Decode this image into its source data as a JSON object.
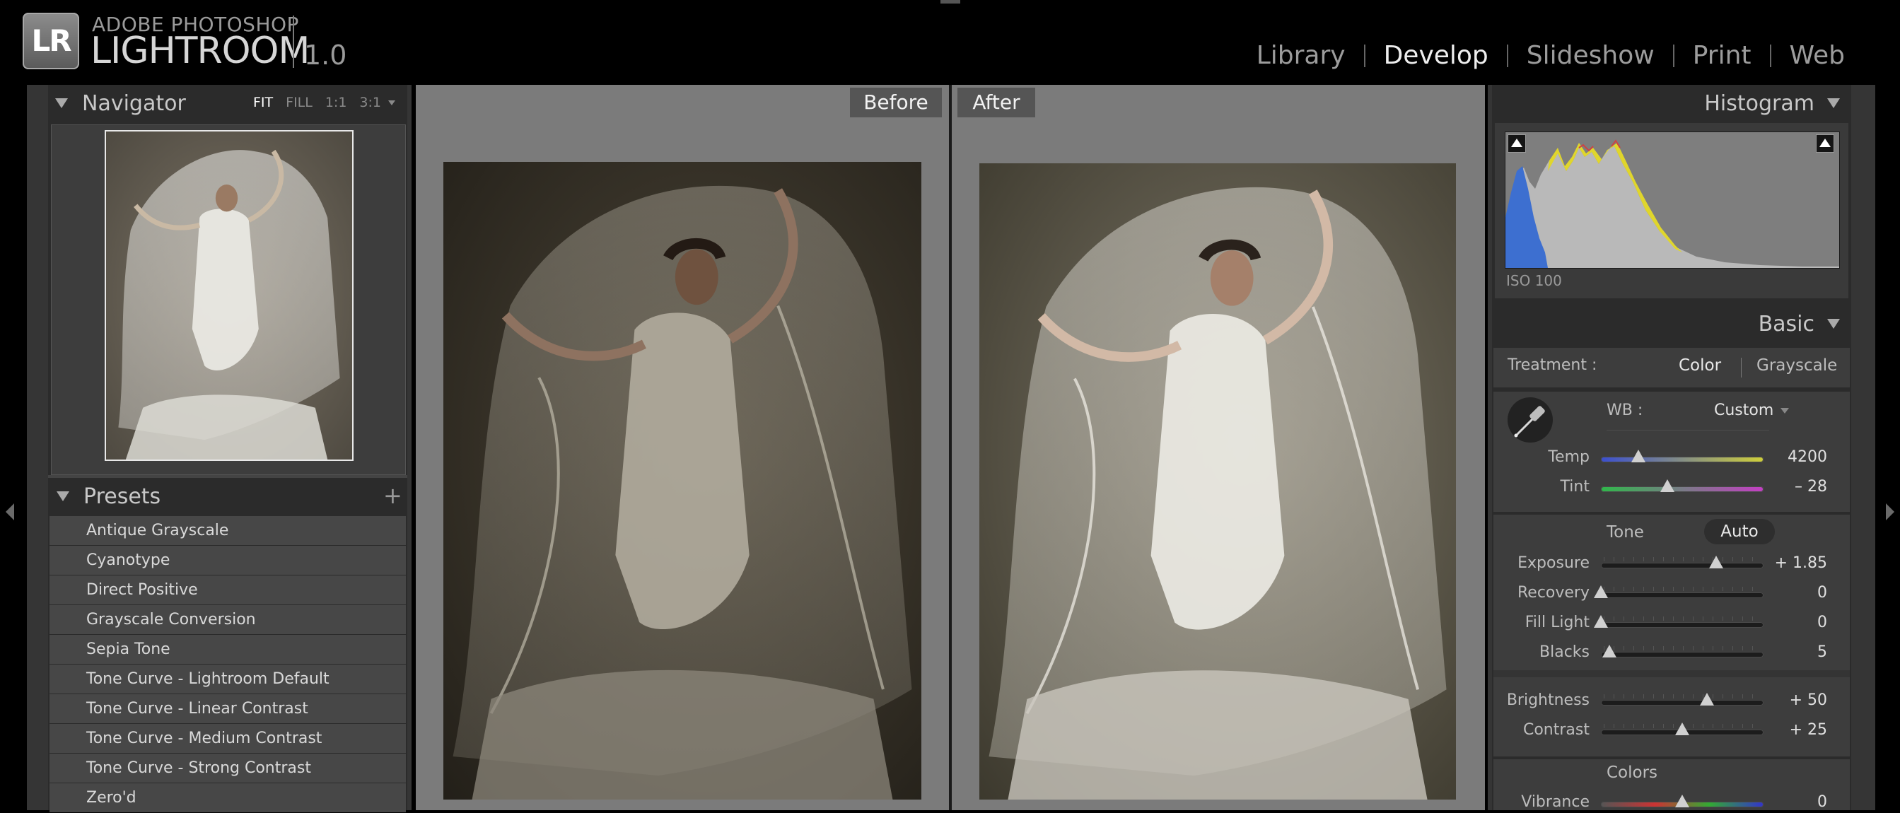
{
  "app": {
    "logo_badge": "LR",
    "brand_top": "ADOBE PHOTOSHOP",
    "brand_main": "LIGHTROOM",
    "version": "1.0"
  },
  "modules": [
    {
      "label": "Library",
      "active": false
    },
    {
      "label": "Develop",
      "active": true
    },
    {
      "label": "Slideshow",
      "active": false
    },
    {
      "label": "Print",
      "active": false
    },
    {
      "label": "Web",
      "active": false
    }
  ],
  "navigator": {
    "title": "Navigator",
    "zoom": {
      "fit": "FIT",
      "fill": "FILL",
      "one_to_one": "1:1",
      "custom": "3:1",
      "active": "FIT"
    }
  },
  "presets": {
    "title": "Presets",
    "add_glyph": "+",
    "items": [
      "Antique Grayscale",
      "Cyanotype",
      "Direct Positive",
      "Grayscale Conversion",
      "Sepia Tone",
      "Tone Curve - Lightroom Default",
      "Tone Curve - Linear Contrast",
      "Tone Curve - Medium Contrast",
      "Tone Curve - Strong Contrast",
      "Zero'd"
    ]
  },
  "view": {
    "before_label": "Before",
    "after_label": "After"
  },
  "histogram": {
    "title": "Histogram",
    "iso": "ISO 100"
  },
  "basic": {
    "title": "Basic",
    "treatment_label": "Treatment :",
    "treatment_color": "Color",
    "treatment_grayscale": "Grayscale",
    "treatment_selected": "Color",
    "wb_label": "WB :",
    "wb_value": "Custom",
    "tone_label": "Tone",
    "auto_label": "Auto",
    "colors_label": "Colors",
    "sliders": {
      "temp": {
        "label": "Temp",
        "value": "4200",
        "pos": 0.23
      },
      "tint": {
        "label": "Tint",
        "value": "– 28",
        "pos": 0.41
      },
      "exposure": {
        "label": "Exposure",
        "value": "+ 1.85",
        "pos": 0.71
      },
      "recovery": {
        "label": "Recovery",
        "value": "0",
        "pos": 0.0
      },
      "fill_light": {
        "label": "Fill Light",
        "value": "0",
        "pos": 0.0
      },
      "blacks": {
        "label": "Blacks",
        "value": "5",
        "pos": 0.05
      },
      "brightness": {
        "label": "Brightness",
        "value": "+ 50",
        "pos": 0.65
      },
      "contrast": {
        "label": "Contrast",
        "value": "+ 25",
        "pos": 0.5
      },
      "vibrance": {
        "label": "Vibrance",
        "value": "0",
        "pos": 0.5
      }
    }
  },
  "colors": {
    "background": "#000000",
    "panel": "#353535",
    "canvas": "#7b7b7b",
    "preset_row": "#474747"
  }
}
